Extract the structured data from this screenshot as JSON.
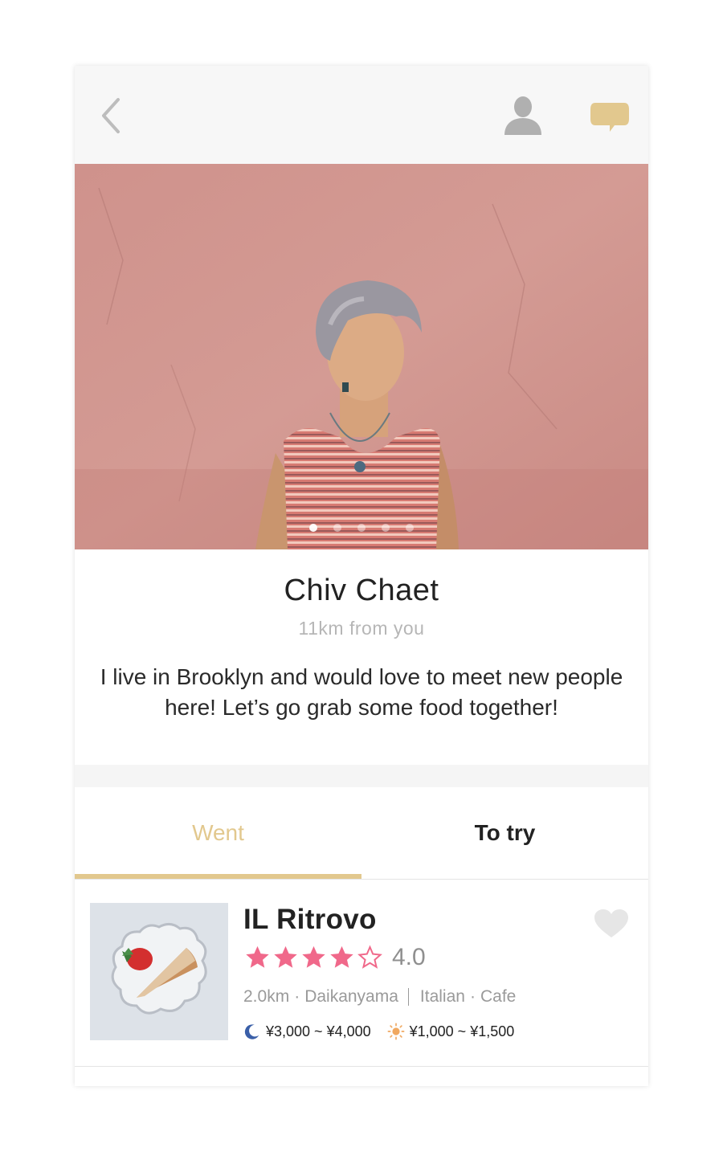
{
  "topbar": {
    "back_icon": "chevron-left-icon",
    "profile_icon": "user-icon",
    "chat_icon": "chat-bubble-icon"
  },
  "hero": {
    "photo_count": 5,
    "active_index": 0,
    "image_subject": "woman with short grey hair in striped top against pink wall"
  },
  "profile": {
    "name": "Chiv Chaet",
    "distance": "11km from you",
    "bio": "I live in Brooklyn and would love to meet new people here! Let’s go grab some food together!"
  },
  "tabs": {
    "went": "Went",
    "to_try": "To try",
    "active": "went"
  },
  "restaurant": {
    "name": "IL Ritrovo",
    "rating_value": 4.0,
    "rating_text": "4.0",
    "stars_filled": 4,
    "stars_total": 5,
    "distance": "2.0km",
    "area": "Daikanyama",
    "cuisine": "Italian",
    "category": "Cafe",
    "dinner_price": "¥3,000 ~ ¥4,000",
    "lunch_price": "¥1,000 ~ ¥1,500",
    "dinner_icon": "moon-icon",
    "lunch_icon": "sun-icon",
    "heart_icon": "heart-icon"
  },
  "colors": {
    "accent": "#e2c88e",
    "star": "#f0688a",
    "icon_grey": "#b0b0b0",
    "heart": "#e6e6e6",
    "moon": "#3a5fa8",
    "sun": "#f0a860"
  }
}
